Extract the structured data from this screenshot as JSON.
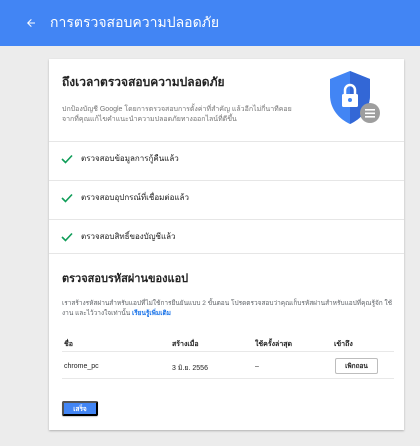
{
  "appbar": {
    "title": "การตรวจสอบความปลอดภัย",
    "back_icon": "arrow-left-icon"
  },
  "intro": {
    "title": "ถึงเวลาตรวจสอบความปลอดภัย",
    "description": "ปกป้องบัญชี Google โดยการตรวจสอบการตั้งค่าที่สำคัญ แล้วอีกไม่กี่นาทีคอยจากที่คุณแก้ไขคำแนะนำความปลอดภัยทางออกไลน์ที่ดีขึ้น",
    "shield_icon": "security-shield-lock-icon"
  },
  "checks": [
    {
      "label": "ตรวจสอบข้อมูลการกู้คืนแล้ว",
      "icon": "check-icon"
    },
    {
      "label": "ตรวจสอบอุปกรณ์ที่เชื่อมต่อแล้ว",
      "icon": "check-icon"
    },
    {
      "label": "ตรวจสอบสิทธิ์ของบัญชีแล้ว",
      "icon": "check-icon"
    }
  ],
  "app_passwords": {
    "title": "ตรวจสอบรหัสผ่านของแอป",
    "description": "เราสร้างรหัสผ่านสำหรับแอปที่ไม่ใช้การยืนยันแบบ 2 ขั้นตอน โปรดตรวจสอบว่าคุณเก็บรหัสผ่านสำหรับแอปที่คุณรู้จัก ใช้งาน และไว้วางใจเท่านั้น",
    "link": "เรียนรู้เพิ่มเติม",
    "columns": [
      "ชื่อ",
      "สร้างเมื่อ",
      "ใช้ครั้งล่าสุด",
      "เข้าถึง"
    ],
    "rows": [
      {
        "name": "chrome_pc",
        "created": "3 มิ.ย. 2556",
        "last_used": "–",
        "action": "เพิกถอน"
      }
    ]
  },
  "done_button": "เสร็จ",
  "colors": {
    "primary": "#4285f4",
    "check_green": "#0f9d58",
    "background": "#ececec",
    "link": "#1a73e8"
  }
}
